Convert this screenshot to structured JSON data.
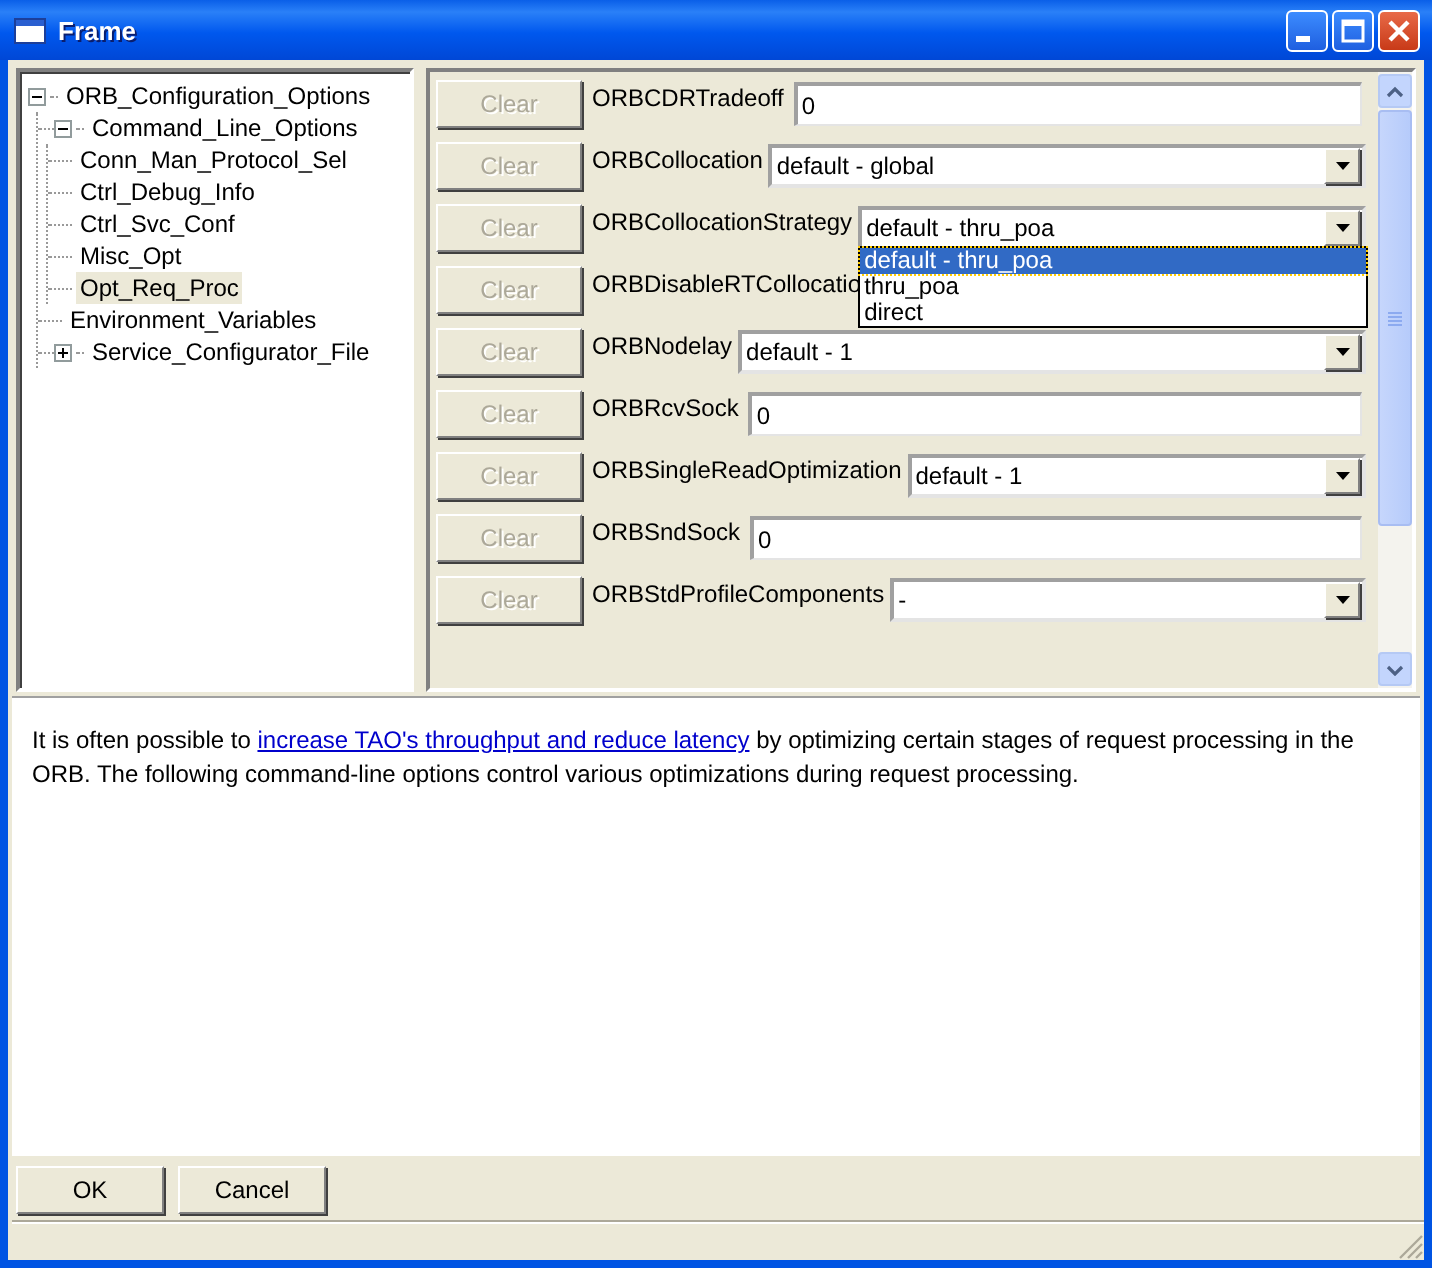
{
  "window": {
    "title": "Frame"
  },
  "tree": [
    {
      "label": "ORB_Configuration_Options",
      "expanded": true,
      "selected": false,
      "children": [
        {
          "label": "Command_Line_Options",
          "expanded": true,
          "selected": false,
          "children": [
            {
              "label": "Conn_Man_Protocol_Sel",
              "selected": false
            },
            {
              "label": "Ctrl_Debug_Info",
              "selected": false
            },
            {
              "label": "Ctrl_Svc_Conf",
              "selected": false
            },
            {
              "label": "Misc_Opt",
              "selected": false
            },
            {
              "label": "Opt_Req_Proc",
              "selected": true
            }
          ]
        },
        {
          "label": "Environment_Variables",
          "selected": false
        },
        {
          "label": "Service_Configurator_File",
          "expanded": false,
          "selected": false
        }
      ]
    }
  ],
  "options": [
    {
      "clear": "Clear",
      "disabled": true,
      "label": "ORBCDRTradeoff",
      "kind": "text",
      "value": "0"
    },
    {
      "clear": "Clear",
      "disabled": true,
      "label": "ORBCollocation",
      "kind": "combo",
      "value": "default - global"
    },
    {
      "clear": "Clear",
      "disabled": true,
      "label": "ORBCollocationStrategy",
      "kind": "combo",
      "value": "default - thru_poa",
      "open": true,
      "choices": [
        {
          "label": "default - thru_poa",
          "selected": true
        },
        {
          "label": "thru_poa",
          "selected": false
        },
        {
          "label": "direct",
          "selected": false
        }
      ]
    },
    {
      "clear": "Clear",
      "disabled": true,
      "label": "ORBDisableRTCollocatio",
      "kind": "hidden"
    },
    {
      "clear": "Clear",
      "disabled": true,
      "label": "ORBNodelay",
      "kind": "combo",
      "value": "default - 1"
    },
    {
      "clear": "Clear",
      "disabled": true,
      "label": "ORBRcvSock",
      "kind": "text",
      "value": "0"
    },
    {
      "clear": "Clear",
      "disabled": true,
      "label": "ORBSingleReadOptimization",
      "kind": "combo",
      "value": "default - 1"
    },
    {
      "clear": "Clear",
      "disabled": true,
      "label": "ORBSndSock",
      "kind": "text",
      "value": "0"
    },
    {
      "clear": "Clear",
      "disabled": true,
      "label": "ORBStdProfileComponents",
      "kind": "combo",
      "value": "-"
    }
  ],
  "description": {
    "before": "It is often possible to ",
    "link": "increase TAO's throughput and reduce latency",
    "after": " by optimizing certain stages of request processing in the ORB. The following command-line options control various optimizations during request processing."
  },
  "buttons": [
    "OK",
    "Cancel"
  ]
}
